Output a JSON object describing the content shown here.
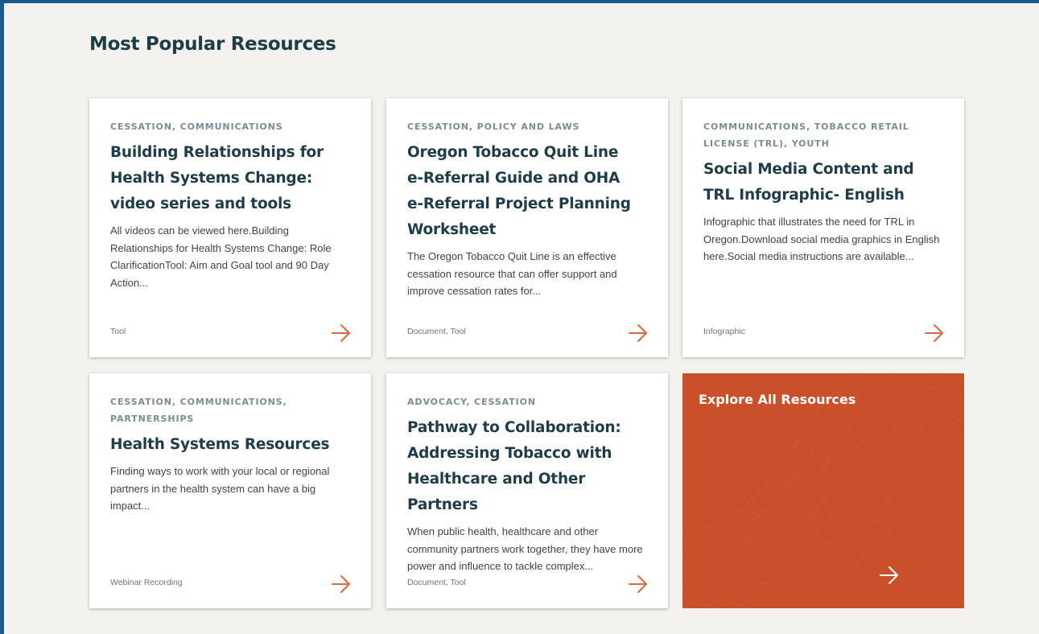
{
  "section": {
    "title": "Most Popular Resources"
  },
  "colors": {
    "accent": "#d86a44",
    "navy": "#1f3d46",
    "frame": "#1c5a8c",
    "explore_bg": "#c9502a"
  },
  "cards": [
    {
      "tags": "CESSATION, COMMUNICATIONS",
      "title": "Building Relationships for Health Systems Change: video series and tools",
      "description": "All videos can be viewed here.Building Relationships for Health Systems Change: Role ClarificationTool: Aim and Goal tool and 90 Day Action...",
      "types": [
        "Tool"
      ]
    },
    {
      "tags": "CESSATION, POLICY AND LAWS",
      "title": "Oregon Tobacco Quit Line e-Referral Guide and OHA e-Referral Project Planning Worksheet",
      "description": "The Oregon Tobacco Quit Line is an effective cessation resource that can offer support and improve cessation rates for...",
      "types": [
        "Document",
        "Tool"
      ]
    },
    {
      "tags": "COMMUNICATIONS, TOBACCO RETAIL LICENSE (TRL), YOUTH",
      "title": "Social Media Content and TRL Infographic- English",
      "description": "Infographic that illustrates the need for TRL in Oregon.Download social media graphics in English here.Social media instructions are available...",
      "types": [
        "Infographic"
      ]
    },
    {
      "tags": "CESSATION, COMMUNICATIONS, PARTNERSHIPS",
      "title": "Health Systems Resources",
      "description": "Finding ways to work with your local or regional partners in the health system can have a big impact...",
      "types": [
        "Webinar Recording"
      ]
    },
    {
      "tags": "ADVOCACY, CESSATION",
      "title": "Pathway to Collaboration: Addressing Tobacco with Healthcare and Other Partners",
      "description": "When public health, healthcare and other community partners work together, they have more power and influence to tackle complex...",
      "types": [
        "Document",
        "Tool"
      ]
    }
  ],
  "explore": {
    "label": "Explore All Resources",
    "icon": "arrow-right-icon"
  },
  "card_icon": "arrow-right-icon",
  "type_separator": ", "
}
